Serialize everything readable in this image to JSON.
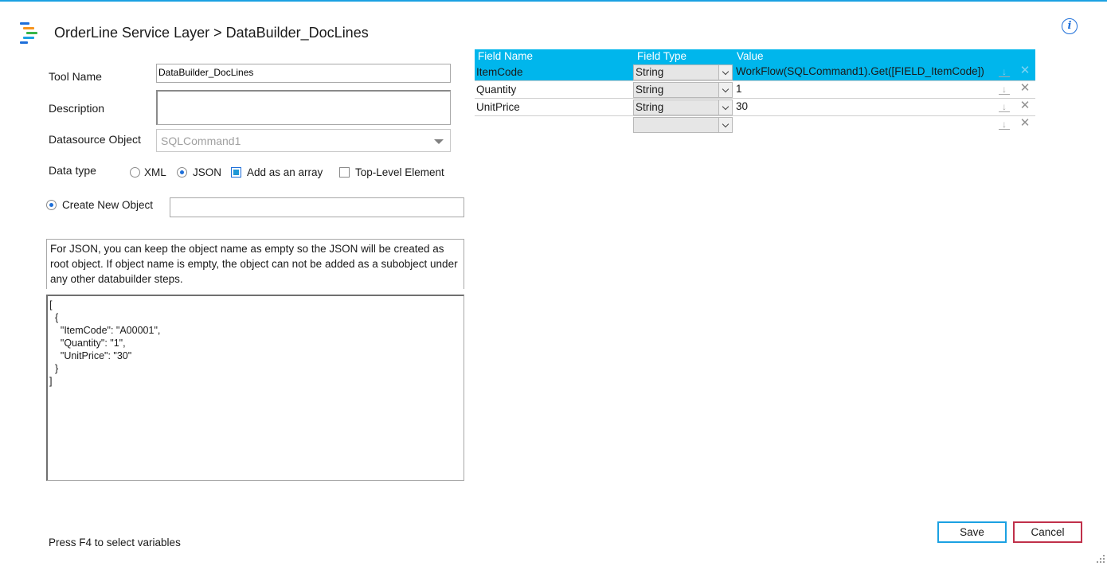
{
  "header": {
    "title": "OrderLine Service Layer > DataBuilder_DocLines",
    "info_icon": "info-icon",
    "logo_colors": [
      "#1e6fd9",
      "#f7941d",
      "#39b54a",
      "#1ba1e2",
      "#e04d4d"
    ]
  },
  "form": {
    "tool_name_label": "Tool Name",
    "tool_name_value": "DataBuilder_DocLines",
    "description_label": "Description",
    "description_value": "",
    "datasource_label": "Datasource Object",
    "datasource_value": "SQLCommand1",
    "datatype_label": "Data type",
    "xml_label": "XML",
    "json_label": "JSON",
    "add_array_label": "Add as an array",
    "top_level_label": "Top-Level Element",
    "datatype_selected": "JSON",
    "add_array_checked": true,
    "top_level_checked": false,
    "create_new_object_label": "Create New Object",
    "create_new_object_value": ""
  },
  "note": "For JSON, you can keep the object name as empty so the JSON will be created as root object.  If object name is empty, the object can not be added as a subobject under any other databuilder steps.",
  "json_preview": "[\n  {\n    \"ItemCode\": \"A00001\",\n    \"Quantity\": \"1\",\n    \"UnitPrice\": \"30\"\n  }\n]",
  "grid": {
    "headers": [
      "Field Name",
      "Field Type",
      "Value"
    ],
    "rows": [
      {
        "name": "ItemCode",
        "type": "String",
        "value": "WorkFlow(SQLCommand1).Get([FIELD_ItemCode])",
        "selected": true
      },
      {
        "name": "Quantity",
        "type": "String",
        "value": "1",
        "selected": false
      },
      {
        "name": "UnitPrice",
        "type": "String",
        "value": "30",
        "selected": false
      },
      {
        "name": "",
        "type": "",
        "value": "",
        "selected": false
      }
    ]
  },
  "footer": {
    "hint": "Press F4 to select variables",
    "save_label": "Save",
    "cancel_label": "Cancel"
  },
  "colors": {
    "accent": "#00b6ec",
    "cancel_border": "#c0304a"
  }
}
